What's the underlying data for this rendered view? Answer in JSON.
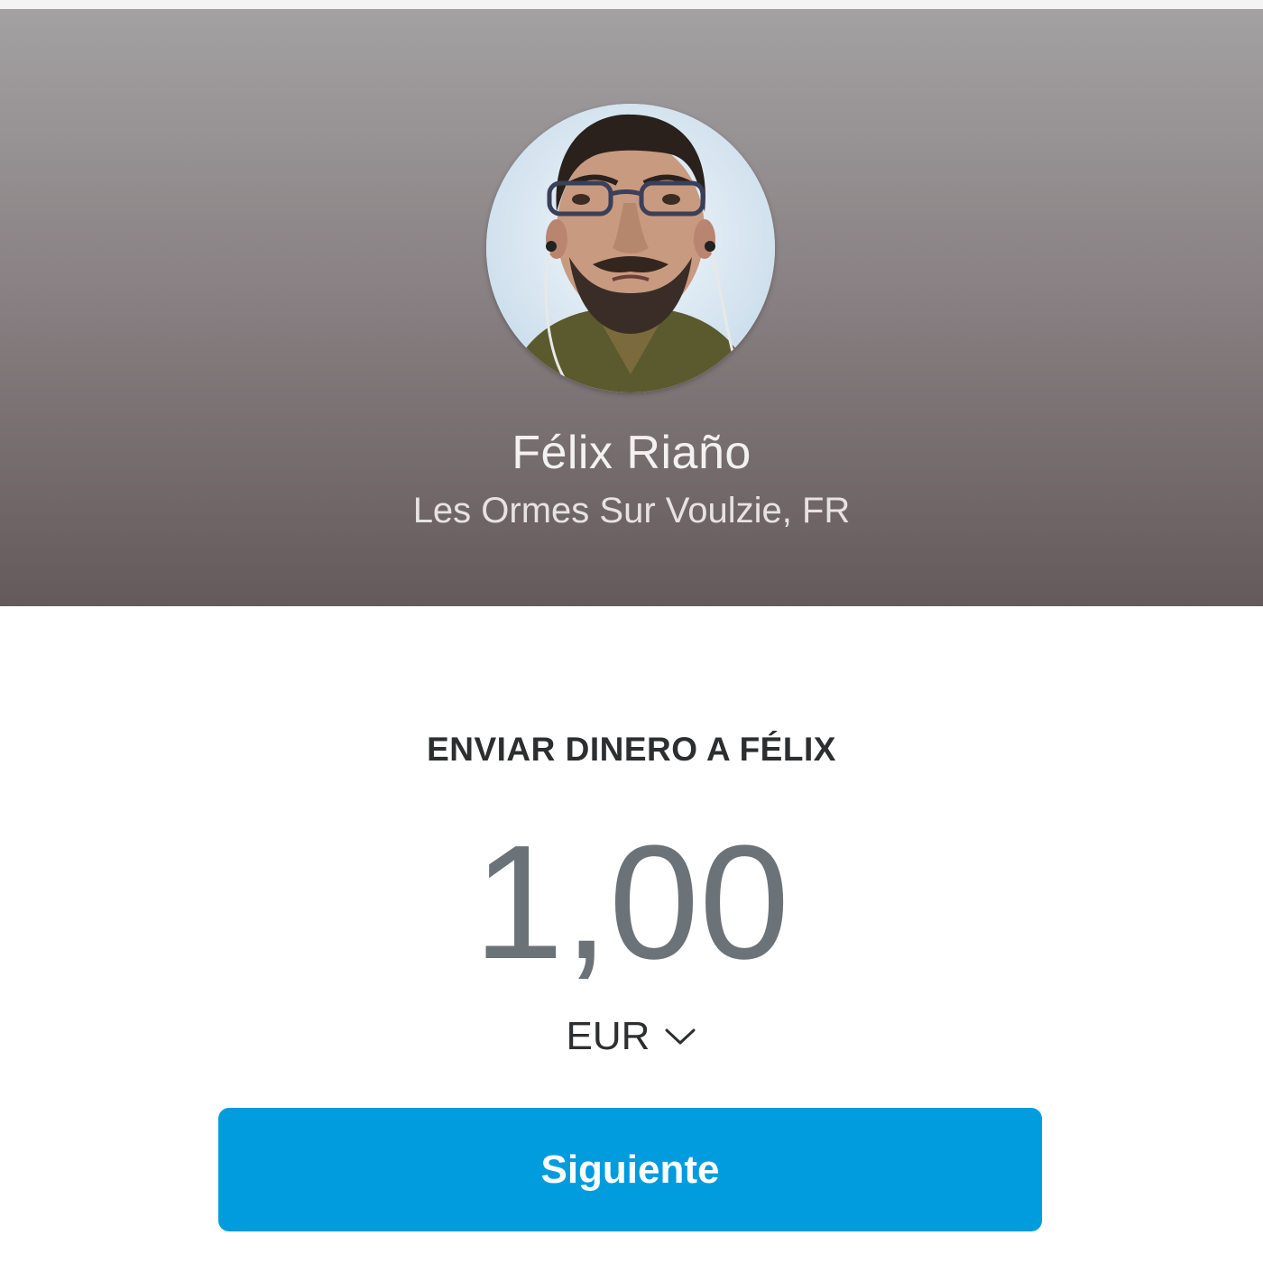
{
  "profile": {
    "name": "Félix Riaño",
    "location": "Les Ormes Sur Voulzie, FR"
  },
  "send": {
    "title": "ENVIAR DINERO A FÉLIX",
    "amount": "1,00",
    "currency": "EUR"
  },
  "actions": {
    "next_label": "Siguiente"
  },
  "colors": {
    "accent": "#009cde",
    "header_top": "#a3a1a2",
    "header_bottom": "#645a5c",
    "amount_text": "#6c7378",
    "title_text": "#2c2e2f"
  },
  "icons": {
    "currency_dropdown": "chevron-down-icon",
    "avatar": "avatar-photo"
  }
}
